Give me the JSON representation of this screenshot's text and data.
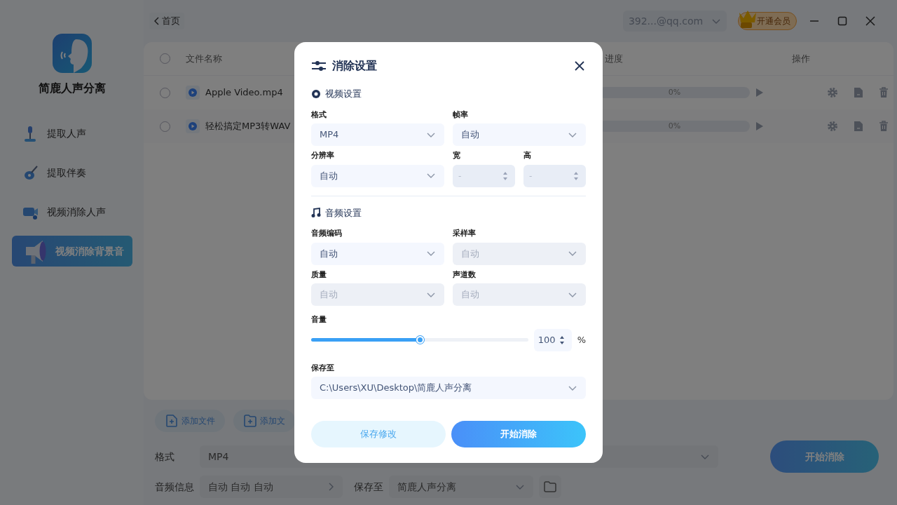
{
  "sidebar": {
    "app_name": "简鹿人声分离",
    "items": [
      {
        "label": "提取人声",
        "kind": "mic",
        "selected": false
      },
      {
        "label": "提取伴奏",
        "kind": "guitar",
        "selected": false
      },
      {
        "label": "视频消除人声",
        "kind": "camera",
        "selected": false
      },
      {
        "label": "视频消除背景音",
        "kind": "speaker",
        "selected": true
      }
    ]
  },
  "topbar": {
    "back": "首页",
    "account": "392...@qq.com",
    "vip": "开通会员"
  },
  "file_table": {
    "select_all": {
      "checked": false
    },
    "columns": [
      "文件名称",
      "进度",
      "操作"
    ],
    "rows": [
      {
        "name": "Apple Video.mp4",
        "checked": false,
        "progress": "0%",
        "level": 0
      },
      {
        "name": "轻松搞定MP3转WAV",
        "checked": false,
        "progress": "0%",
        "level": 0
      }
    ]
  },
  "bottom": {
    "add_buttons": [
      {
        "label": "添加文件",
        "kind": "file"
      },
      {
        "label": "添加文",
        "kind": "folder"
      }
    ],
    "format": {
      "label": "格式",
      "value": "MP4"
    },
    "audio_info": {
      "label": "音频信息",
      "value": "自动 自动 自动"
    },
    "save_to": {
      "label": "保存至",
      "value": "简鹿人声分离"
    },
    "start_button": "开始消除"
  },
  "dialog": {
    "title": "消除设置",
    "sections": [
      {
        "kind": "video",
        "title": "视频设置",
        "fields": [
          {
            "label": "格式",
            "kind": "select",
            "value": "MP4",
            "disabled": false
          },
          {
            "label": "帧率",
            "kind": "select",
            "value": "自动",
            "disabled": false
          },
          {
            "label": "分辨率",
            "kind": "select",
            "value": "自动",
            "disabled": false
          },
          {
            "label": "宽",
            "kind": "number",
            "placeholder": "-",
            "disabled": true
          },
          {
            "label": "高",
            "kind": "number",
            "placeholder": "-",
            "disabled": true
          }
        ]
      },
      {
        "kind": "audio",
        "title": "音频设置",
        "fields": [
          {
            "label": "音频编码",
            "kind": "select",
            "value": "自动",
            "disabled": false
          },
          {
            "label": "采样率",
            "kind": "select",
            "value": "自动",
            "disabled": true
          },
          {
            "label": "质量",
            "kind": "select",
            "value": "自动",
            "disabled": true
          },
          {
            "label": "声道数",
            "kind": "select",
            "value": "自动",
            "disabled": true
          }
        ]
      }
    ],
    "volume": {
      "label": "音量",
      "level": 0.5,
      "reading": "100",
      "unit": "%"
    },
    "save_to": {
      "label": "保存至",
      "value": "C:\\Users\\XU\\Desktop\\简鹿人声分离"
    },
    "buttons": [
      {
        "label": "保存修改",
        "kind": "secondary"
      },
      {
        "label": "开始消除",
        "kind": "primary"
      }
    ]
  }
}
